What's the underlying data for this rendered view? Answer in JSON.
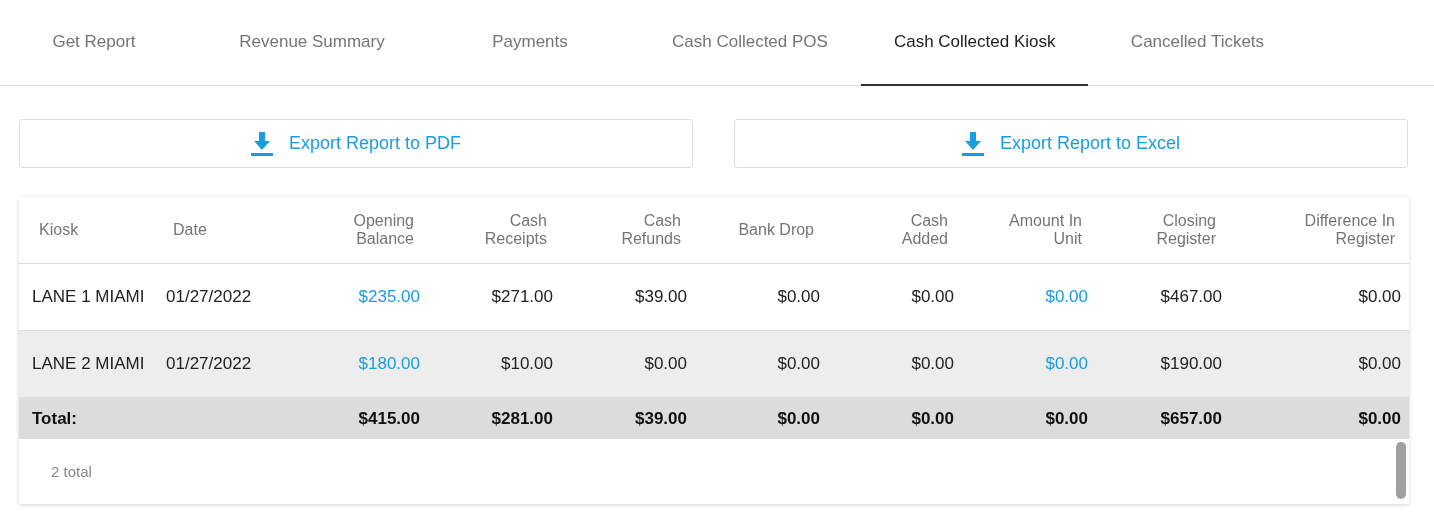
{
  "tabs": [
    {
      "label": "Get Report",
      "selected": false
    },
    {
      "label": "Revenue Summary",
      "selected": false
    },
    {
      "label": "Payments",
      "selected": false
    },
    {
      "label": "Cash Collected POS",
      "selected": false
    },
    {
      "label": "Cash Collected Kiosk",
      "selected": true
    },
    {
      "label": "Cancelled Tickets",
      "selected": false
    }
  ],
  "export_buttons": [
    {
      "label": "Export Report to PDF"
    },
    {
      "label": "Export Report to Excel"
    }
  ],
  "table": {
    "columns": [
      "Kiosk",
      "Date",
      "Opening\nBalance",
      "Cash\nReceipts",
      "Cash\nRefunds",
      "Bank Drop",
      "Cash\nAdded",
      "Amount In\nUnit",
      "Closing\nRegister",
      "Difference In\nRegister"
    ],
    "rows": [
      {
        "hovered": false,
        "cells": [
          {
            "text": "LANE 1 MIAMI",
            "link": false
          },
          {
            "text": "01/27/2022",
            "link": false
          },
          {
            "text": "$235.00",
            "link": true
          },
          {
            "text": "$271.00",
            "link": false
          },
          {
            "text": "$39.00",
            "link": false
          },
          {
            "text": "$0.00",
            "link": false
          },
          {
            "text": "$0.00",
            "link": false
          },
          {
            "text": "$0.00",
            "link": true
          },
          {
            "text": "$467.00",
            "link": false
          },
          {
            "text": "$0.00",
            "link": false
          }
        ]
      },
      {
        "hovered": true,
        "cells": [
          {
            "text": "LANE 2 MIAMI",
            "link": false
          },
          {
            "text": "01/27/2022",
            "link": false
          },
          {
            "text": "$180.00",
            "link": true
          },
          {
            "text": "$10.00",
            "link": false
          },
          {
            "text": "$0.00",
            "link": false
          },
          {
            "text": "$0.00",
            "link": false
          },
          {
            "text": "$0.00",
            "link": false
          },
          {
            "text": "$0.00",
            "link": true
          },
          {
            "text": "$190.00",
            "link": false
          },
          {
            "text": "$0.00",
            "link": false
          }
        ]
      }
    ],
    "total_row": {
      "label": "Total:",
      "values": [
        "$415.00",
        "$281.00",
        "$39.00",
        "$0.00",
        "$0.00",
        "$0.00",
        "$657.00",
        "$0.00"
      ]
    },
    "footer": "2 total"
  }
}
